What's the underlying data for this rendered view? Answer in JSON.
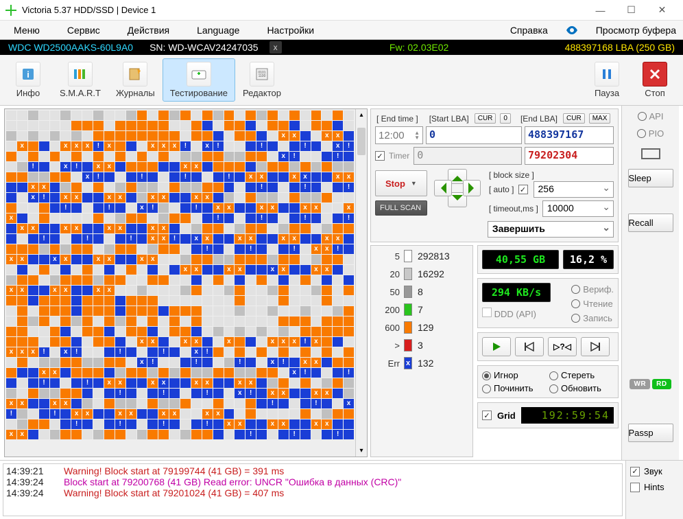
{
  "window": {
    "title": "Victoria 5.37 HDD/SSD | Device 1"
  },
  "menu": {
    "items": [
      "Меню",
      "Сервис",
      "Действия",
      "Language",
      "Настройки"
    ],
    "help": "Справка",
    "buffer_view": "Просмотр буфера"
  },
  "device_strip": {
    "model": "WDC WD2500AAKS-60L9A0",
    "sn_label": "SN: ",
    "sn": "WD-WCAV24247035",
    "fw_label": "Fw: ",
    "fw": "02.03E02",
    "lba": "488397168 LBA (250 GB)"
  },
  "toolbar": {
    "info": "Инфо",
    "smart": "S.M.A.R.T",
    "journals": "Журналы",
    "testing": "Тестирование",
    "editor": "Редактор",
    "pause": "Пауза",
    "stop": "Стоп"
  },
  "scan_controls": {
    "end_time_label": "[ End time ]",
    "start_lba_label": "[Start LBA]",
    "end_lba_label": "[End LBA]",
    "cur_btn": "CUR",
    "zero_btn": "0",
    "max_btn": "MAX",
    "end_time": "12:00",
    "start_lba": "0",
    "end_lba": "488397167",
    "timer_label": "Timer",
    "timer_value": "0",
    "current_lba": "79202304",
    "stop_btn": "Stop",
    "full_scan_btn": "FULL SCAN",
    "block_size_label": "[ block size ]",
    "auto_label": "[ auto ]",
    "block_size": "256",
    "timeout_label": "[ timeout,ms ]",
    "timeout": "10000",
    "action_select": "Завершить"
  },
  "legend": {
    "rows": [
      {
        "threshold": "5",
        "color": "#ffffff",
        "count": "292813"
      },
      {
        "threshold": "20",
        "color": "#c8c8c8",
        "count": "16292"
      },
      {
        "threshold": "50",
        "color": "#989898",
        "count": "8"
      },
      {
        "threshold": "200",
        "color": "#2ac41d",
        "count": "7"
      },
      {
        "threshold": "600",
        "color": "#f97a00",
        "count": "129"
      },
      {
        "threshold": ">",
        "color": "#d81e1e",
        "count": "3"
      },
      {
        "threshold": "Err",
        "color": "#1a3ed6",
        "count": "132",
        "mark": true
      }
    ]
  },
  "status": {
    "scanned": "40,55 GB",
    "percent": "16,2  %",
    "speed": "294 KB/s",
    "verify": "Вериф.",
    "ddd": "DDD (API)",
    "read": "Чтение",
    "write": "Запись",
    "ignore": "Игнор",
    "erase": "Стереть",
    "repair": "Починить",
    "refresh": "Обновить",
    "grid": "Grid",
    "elapsed": "192:59:54"
  },
  "sidebar": {
    "api": "API",
    "pio": "PIO",
    "sleep": "Sleep",
    "recall": "Recall",
    "wr": "WR",
    "rd": "RD",
    "passp": "Passp"
  },
  "checkboxes": {
    "sound": "Звук",
    "hints": "Hints"
  },
  "log": [
    {
      "ts": "14:39:21",
      "msg": "Warning! Block start at 79199744 (41 GB)  = 391 ms",
      "cls": "red"
    },
    {
      "ts": "14:39:24",
      "msg": "Block start at 79200768 (41 GB) Read error: UNCR \"Ошибка в данных (CRC)\"",
      "cls": "mag"
    },
    {
      "ts": "14:39:24",
      "msg": "Warning! Block start at 79201024 (41 GB)  = 407 ms",
      "cls": "red"
    }
  ],
  "blockmap_pattern": "eegeegeegeegoeogoeogoeogoeoeoeoeeeeeeeoooeoooooeeobeoobeoobeoobegegegegeooooooooeoobeoobeOObeOObeOobeOOOEOobeOOOEeBEeebEbebEbeBEoeoeoeoeoeoeoeoeggooggooeBEeebEbegEbeBEbOObooobbOObooobgoogogoggooggooeBEbebEbebEbebEbOObbOBbbOObbOObgoeoegoggeoggoobebEbebEbebEbeBEbOObbOObgOObbOObgeoggeoggoeeoeeobEbebEbeBEgebEbOObbOObbOOeeOObeoeeeeoegooegooebEbebEbebEbebEbOObbOObbOObbOObegooegooegooegoobebEbebEbebEbOOEbBObbOObbOObbOObooogogooegooegooebEbebEbebEeOOEbOObbBObbOObbOOeegooggooogooegooeebeoebeoebeoebebOObbOObbBObbOObegooegooogooeeooeebeoebeoebeoebebOObbOObbOOeegeeegoeegoeegoeegoeoooboooboooboooeeeeeeeoeeeoeeeoeeeoeoooboooboooboooe"
}
